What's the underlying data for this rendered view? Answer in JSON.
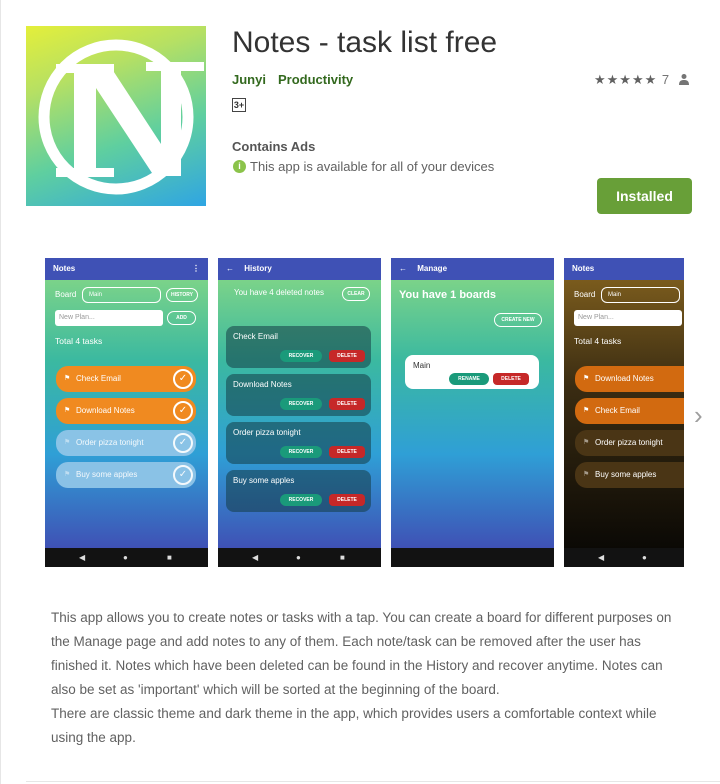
{
  "app": {
    "title": "Notes - task list free",
    "developer": "Junyi",
    "category": "Productivity",
    "rating_stars": "★★★★★",
    "rating_count": "7",
    "age_rating": "3+",
    "contains_ads": "Contains Ads",
    "availability": "This app is available for all of your devices",
    "install_label": "Installed",
    "colors": {
      "accent": "#689f38",
      "link": "#33691e"
    }
  },
  "icons": {
    "app_icon": "notes-n-logo-icon",
    "person": "person-icon",
    "info": "info-icon",
    "chevron": "chevron-right-icon",
    "check_glyph": "✓",
    "info_glyph": "i",
    "flag_glyph": "⚑",
    "chevron_glyph": "›",
    "back_glyph": "←",
    "menu_glyph": "⋮",
    "nav_back_glyph": "◀",
    "nav_home_glyph": "●",
    "nav_recent_glyph": "■"
  },
  "screenshots": [
    {
      "title": "Notes",
      "board_label": "Board",
      "board_value": "Main",
      "history_btn": "HISTORY",
      "input_placeholder": "New Plan...",
      "add_btn": "ADD",
      "total": "Total 4 tasks",
      "tasks": [
        "Check Email",
        "Download Notes",
        "Order pizza tonight",
        "Buy some apples"
      ]
    },
    {
      "title": "History",
      "deleted_msg": "You have 4 deleted notes",
      "clear_btn": "CLEAR",
      "recover_label": "RECOVER",
      "delete_label": "DELETE",
      "items": [
        "Check Email",
        "Download Notes",
        "Order pizza tonight",
        "Buy some apples"
      ]
    },
    {
      "title": "Manage",
      "boards_msg": "You have 1 boards",
      "create_btn": "CREATE NEW",
      "board_name": "Main",
      "rename_label": "RENAME",
      "delete_label": "DELETE"
    },
    {
      "title": "Notes",
      "board_label": "Board",
      "board_value": "Main",
      "input_placeholder": "New Plan...",
      "total": "Total 4 tasks",
      "tasks": [
        "Download Notes",
        "Check Email",
        "Order pizza tonight",
        "Buy some apples"
      ]
    }
  ],
  "description": {
    "p1": "This app allows you to create notes or tasks with a tap. You can create a board for different purposes on the Manage page and add notes to any of them. Each note/task can be removed after the user has finished it. Notes which have been deleted can be found in the History and recover anytime. Notes can also be set as 'important' which will be sorted at the beginning of the board.",
    "p2": "There are classic theme and dark theme in the app, which provides users a comfortable context while using the app."
  }
}
